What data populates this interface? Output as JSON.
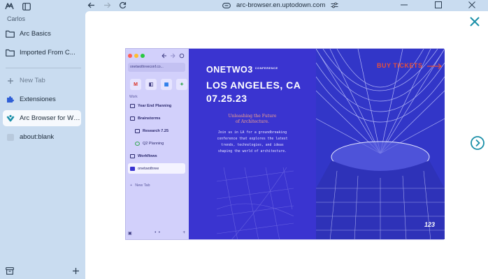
{
  "sidebar": {
    "profile": "Carlos",
    "folders": [
      {
        "label": "Arc Basics"
      },
      {
        "label": "Imported From C..."
      }
    ],
    "new_tab": "New Tab",
    "tabs": [
      {
        "label": "Extensiones",
        "icon": "puzzle-icon"
      },
      {
        "label": "Arc Browser for Win...",
        "icon": "arc-download-icon"
      },
      {
        "label": "about:blank",
        "icon": "blank-page-icon"
      }
    ]
  },
  "toolbar": {
    "url": "arc-browser.en.uptodown.com"
  },
  "colors": {
    "sidebar_bg": "#c9dcf0",
    "accent_teal": "#1a8fa8",
    "hero_blue": "#3a34d0",
    "ticket_red": "#e5503a"
  },
  "screenshot": {
    "url": "onetwothreeconf.co...",
    "section_label": "Work",
    "items": [
      {
        "label": "Year End Planning"
      },
      {
        "label": "Brainstorms"
      },
      {
        "label": "Research 7.25"
      },
      {
        "label": "Q2 Planning"
      },
      {
        "label": "Workflows"
      },
      {
        "label": "onetwothree"
      }
    ],
    "new_tab": "New Tab",
    "hero": {
      "title": "ONETWO3",
      "tag": "CONFERENCE",
      "city": "LOS ANGELES, CA",
      "date": "07.25.23",
      "subtitle_1": "Unleashing the Future",
      "subtitle_2": "of Architecture.",
      "body": "Join us in LA for a groundbreaking conference that explores the latest trends, technologies, and ideas shaping the world of architecture."
    },
    "buy_tickets": "BUY TICKETS",
    "logo": "123"
  }
}
